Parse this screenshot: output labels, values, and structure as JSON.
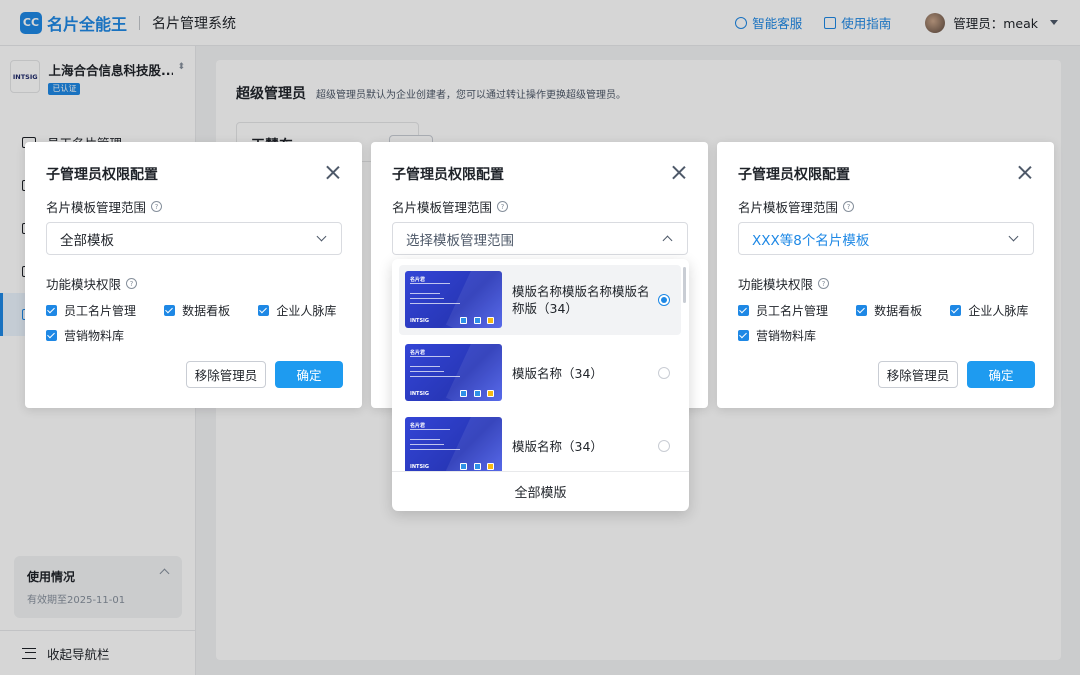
{
  "app": {
    "logo_mark": "CC",
    "brand_name": "名片全能王",
    "system_title": "名片管理系统"
  },
  "header": {
    "support_label": "智能客服",
    "guide_label": "使用指南",
    "user_label": "管理员：meak"
  },
  "sidebar": {
    "company_logo_text": "INTSIG",
    "company_name": "上海合合信息科技股...",
    "company_switch": "⬍",
    "verified_badge": "已认证",
    "items": [
      {
        "label": "员工名片管理",
        "active": false
      },
      {
        "label": "",
        "active": false
      },
      {
        "label": "",
        "active": false
      },
      {
        "label": "",
        "active": false
      },
      {
        "label": "",
        "active": true
      }
    ],
    "usage": {
      "title": "使用情况",
      "subtitle": "有效期至2025-11-01"
    },
    "collapse_label": "收起导航栏"
  },
  "main": {
    "title": "超级管理员",
    "description": "超级管理员默认为企业创建者，您可以通过转让操作更换超级管理员。",
    "hint_card_text": "王慧东"
  },
  "modals": [
    {
      "title": "子管理员权限配置",
      "scope_label": "名片模板管理范围",
      "scope_value": "全部模板",
      "perm_label": "功能模块权限",
      "perms": [
        "员工名片管理",
        "数据看板",
        "企业人脉库",
        "营销物料库"
      ],
      "remove_label": "移除管理员",
      "confirm_label": "确定"
    },
    {
      "title": "子管理员权限配置",
      "scope_label": "名片模板管理范围",
      "scope_value": "选择模板管理范围"
    },
    {
      "title": "子管理员权限配置",
      "scope_label": "名片模板管理范围",
      "scope_value": "XXX等8个名片模板",
      "perm_label": "功能模块权限",
      "perms": [
        "员工名片管理",
        "数据看板",
        "企业人脉库",
        "营销物料库"
      ],
      "remove_label": "移除管理员",
      "confirm_label": "确定"
    }
  ],
  "dropdown": {
    "options": [
      {
        "label": "模版名称模版名称模版名称版（34）",
        "selected": true,
        "card_name": "名片君",
        "card_brand": "INTSIG"
      },
      {
        "label": "模版名称（34）",
        "selected": false,
        "card_name": "名片君",
        "card_brand": "INTSIG"
      },
      {
        "label": "模版名称（34）",
        "selected": false,
        "card_name": "名片君",
        "card_brand": "INTSIG"
      }
    ],
    "footer_label": "全部模版"
  },
  "colors": {
    "accent": "#1e88e5",
    "primary_button": "#1e9bf0"
  }
}
